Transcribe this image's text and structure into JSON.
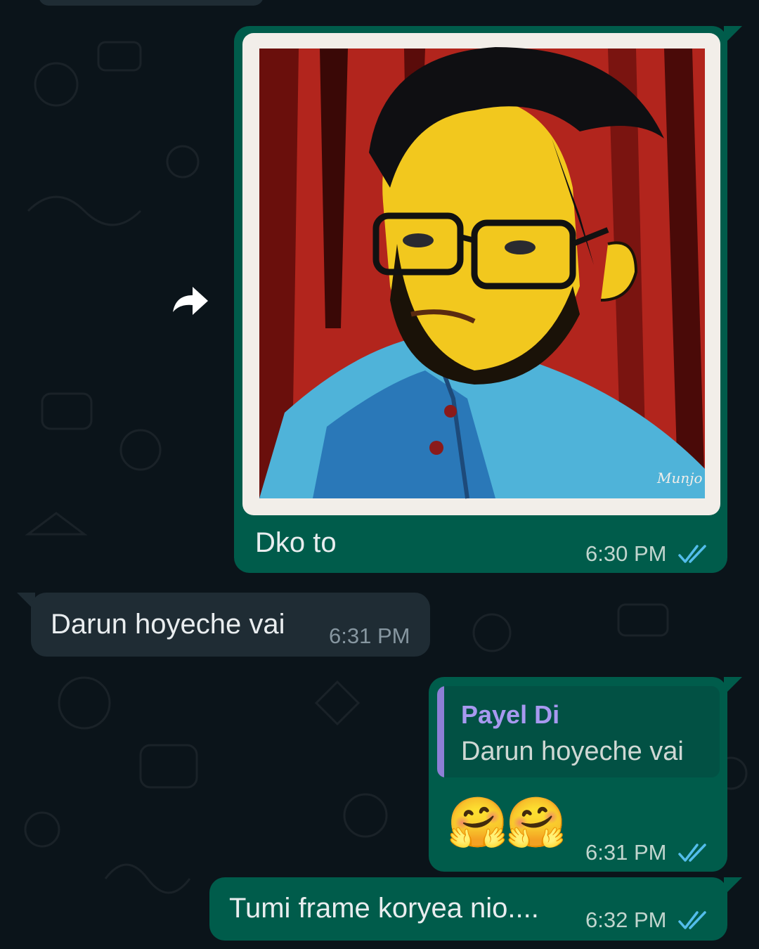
{
  "messages": [
    {
      "id": "m1",
      "direction": "outgoing",
      "type": "image",
      "caption": "Dko to",
      "time": "6:30 PM",
      "status": "read",
      "image": {
        "subject": "painted-portrait",
        "signature": "Munjo"
      }
    },
    {
      "id": "m2",
      "direction": "incoming",
      "type": "text",
      "text": "Darun hoyeche vai",
      "time": "6:31 PM"
    },
    {
      "id": "m3",
      "direction": "outgoing",
      "type": "reply",
      "quoted_author": "Payel Di",
      "quoted_text": "Darun hoyeche vai",
      "text": "🤗🤗",
      "time": "6:31 PM",
      "status": "read"
    },
    {
      "id": "m4",
      "direction": "outgoing",
      "type": "text",
      "text": "Tumi frame koryea nio....",
      "time": "6:32 PM",
      "status": "read"
    }
  ],
  "icons": {
    "forward": "forward-arrow-icon",
    "read_receipt": "double-check-icon"
  },
  "colors": {
    "background": "#0b141a",
    "outgoing_bubble": "#005c4b",
    "incoming_bubble": "#1f2c34",
    "read_tick": "#53bdeb",
    "quote_bar": "#8d7fd6",
    "quote_author": "#a899f0"
  }
}
